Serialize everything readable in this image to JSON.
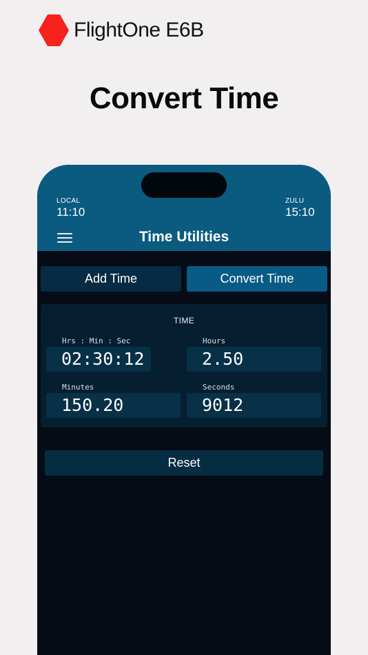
{
  "brand": {
    "name": "FlightOne E6B",
    "logo_color": "#f6221c"
  },
  "headline": "Convert Time",
  "status_bar": {
    "local_label": "LOCAL",
    "local_time": "11:10",
    "zulu_label": "ZULU",
    "zulu_time": "15:10"
  },
  "nav": {
    "title": "Time Utilities",
    "menu_icon": "hamburger-menu-icon"
  },
  "tabs": [
    {
      "label": "Add Time",
      "active": false
    },
    {
      "label": "Convert Time",
      "active": true
    }
  ],
  "panel": {
    "title": "TIME",
    "fields": {
      "hms": {
        "label": "Hrs : Min : Sec",
        "value": "02:30:12"
      },
      "hours": {
        "label": "Hours",
        "value": "2.50"
      },
      "minutes": {
        "label": "Minutes",
        "value": "150.20"
      },
      "seconds": {
        "label": "Seconds",
        "value": "9012"
      }
    }
  },
  "reset_label": "Reset",
  "colors": {
    "header": "#0b5a80",
    "screen_bg": "#050c15",
    "active_tab": "#075b84",
    "inactive_tab": "#062b42",
    "panel_bg": "#051f31",
    "field_bg": "#083047"
  }
}
